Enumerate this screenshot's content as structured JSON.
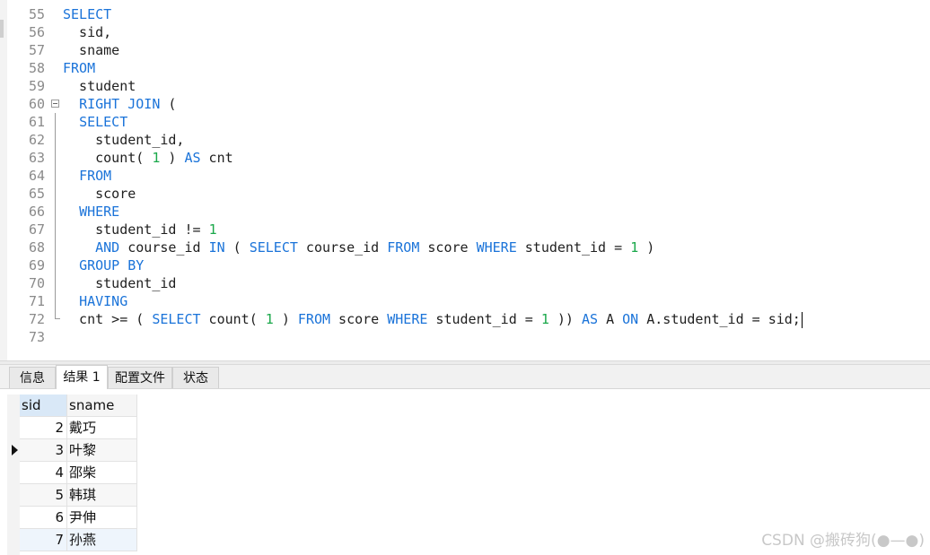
{
  "editor": {
    "lines": [
      {
        "n": "55",
        "tokens": [
          {
            "t": "SELECT",
            "k": 1
          }
        ]
      },
      {
        "n": "56",
        "tokens": [
          {
            "t": "  sid,"
          }
        ]
      },
      {
        "n": "57",
        "tokens": [
          {
            "t": "  sname"
          }
        ]
      },
      {
        "n": "58",
        "tokens": [
          {
            "t": "FROM",
            "k": 1
          }
        ]
      },
      {
        "n": "59",
        "tokens": [
          {
            "t": "  student"
          }
        ]
      },
      {
        "n": "60",
        "fold": "start",
        "tokens": [
          {
            "t": "  "
          },
          {
            "t": "RIGHT JOIN",
            "k": 1
          },
          {
            "t": " ("
          }
        ]
      },
      {
        "n": "61",
        "fold": "mid",
        "tokens": [
          {
            "t": "  "
          },
          {
            "t": "SELECT",
            "k": 1
          }
        ]
      },
      {
        "n": "62",
        "fold": "mid",
        "tokens": [
          {
            "t": "    student_id,"
          }
        ]
      },
      {
        "n": "63",
        "fold": "mid",
        "tokens": [
          {
            "t": "    count( "
          },
          {
            "t": "1",
            "k": 2
          },
          {
            "t": " ) "
          },
          {
            "t": "AS",
            "k": 1
          },
          {
            "t": " cnt"
          }
        ]
      },
      {
        "n": "64",
        "fold": "mid",
        "tokens": [
          {
            "t": "  "
          },
          {
            "t": "FROM",
            "k": 1
          }
        ]
      },
      {
        "n": "65",
        "fold": "mid",
        "tokens": [
          {
            "t": "    score"
          }
        ]
      },
      {
        "n": "66",
        "fold": "mid",
        "tokens": [
          {
            "t": "  "
          },
          {
            "t": "WHERE",
            "k": 1
          }
        ]
      },
      {
        "n": "67",
        "fold": "mid",
        "tokens": [
          {
            "t": "    student_id != "
          },
          {
            "t": "1",
            "k": 2
          }
        ]
      },
      {
        "n": "68",
        "fold": "mid",
        "tokens": [
          {
            "t": "    "
          },
          {
            "t": "AND",
            "k": 1
          },
          {
            "t": " course_id "
          },
          {
            "t": "IN",
            "k": 1
          },
          {
            "t": " ( "
          },
          {
            "t": "SELECT",
            "k": 1
          },
          {
            "t": " course_id "
          },
          {
            "t": "FROM",
            "k": 1
          },
          {
            "t": " score "
          },
          {
            "t": "WHERE",
            "k": 1
          },
          {
            "t": " student_id = "
          },
          {
            "t": "1",
            "k": 2
          },
          {
            "t": " )"
          }
        ]
      },
      {
        "n": "69",
        "fold": "mid",
        "tokens": [
          {
            "t": "  "
          },
          {
            "t": "GROUP BY",
            "k": 1
          }
        ]
      },
      {
        "n": "70",
        "fold": "mid",
        "tokens": [
          {
            "t": "    student_id"
          }
        ]
      },
      {
        "n": "71",
        "fold": "mid",
        "tokens": [
          {
            "t": "  "
          },
          {
            "t": "HAVING",
            "k": 1
          }
        ]
      },
      {
        "n": "72",
        "fold": "end",
        "caret": true,
        "tokens": [
          {
            "t": "  cnt >= ( "
          },
          {
            "t": "SELECT",
            "k": 1
          },
          {
            "t": " count( "
          },
          {
            "t": "1",
            "k": 2
          },
          {
            "t": " ) "
          },
          {
            "t": "FROM",
            "k": 1
          },
          {
            "t": " score "
          },
          {
            "t": "WHERE",
            "k": 1
          },
          {
            "t": " student_id = "
          },
          {
            "t": "1",
            "k": 2
          },
          {
            "t": " )) "
          },
          {
            "t": "AS",
            "k": 1
          },
          {
            "t": " A "
          },
          {
            "t": "ON",
            "k": 1
          },
          {
            "t": " A.student_id = sid;"
          }
        ]
      },
      {
        "n": "73",
        "tokens": []
      }
    ]
  },
  "tabs": [
    {
      "label": "信息",
      "active": false
    },
    {
      "label": "结果 1",
      "active": true
    },
    {
      "label": "配置文件",
      "active": false
    },
    {
      "label": "状态",
      "active": false
    }
  ],
  "grid": {
    "columns": [
      "sid",
      "sname"
    ],
    "rows": [
      [
        "2",
        "戴巧"
      ],
      [
        "3",
        "叶黎"
      ],
      [
        "4",
        "邵柴"
      ],
      [
        "5",
        "韩琪"
      ],
      [
        "6",
        "尹伸"
      ],
      [
        "7",
        "孙燕"
      ]
    ],
    "selected_row": 1
  },
  "watermark": "CSDN @搬砖狗(●—●)",
  "colors": {
    "keyword": "#1a73d9",
    "number": "#1aa84a"
  }
}
